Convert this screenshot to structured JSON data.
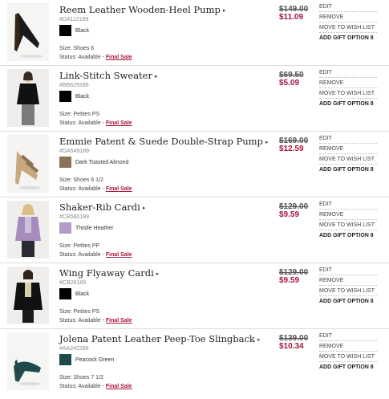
{
  "actions": {
    "edit": "EDIT",
    "remove": "REMOVE",
    "move": "MOVE TO WISH LIST",
    "gift": "ADD GIFT OPTION"
  },
  "status_prefix": "Status: Available -",
  "final_sale": "Final Sale",
  "items": [
    {
      "name": "Reem Leather Wooden-Heel Pump",
      "sku": "#DA112189",
      "color_name": "Black",
      "swatch": "#000000",
      "size": "Size: Shoes 6",
      "original_price": "$149.00",
      "sale_price": "$11.09",
      "gift_count": "8",
      "icon": "black-pump-shoe"
    },
    {
      "name": "Link-Stitch Sweater",
      "sku": "#BB629286",
      "color_name": "Black",
      "swatch": "#000000",
      "size": "Size: Petites PS",
      "original_price": "$69.50",
      "sale_price": "$5.09",
      "gift_count": "8",
      "icon": "model-black-sweater"
    },
    {
      "name": "Emmie Patent & Suede Double-Strap Pump",
      "sku": "#DA549189",
      "color_name": "Dark Toasted Almond",
      "swatch": "#8b7358",
      "size": "Size: Shoes 6 1/2",
      "original_price": "$169.00",
      "sale_price": "$12.59",
      "gift_count": "8",
      "icon": "almond-double-strap-pump"
    },
    {
      "name": "Shaker-Rib Cardi",
      "sku": "#CB580189",
      "color_name": "Thistle Heather",
      "swatch": "#b49ac6",
      "size": "Size: Petites PP",
      "original_price": "$129.00",
      "sale_price": "$9.59",
      "gift_count": "8",
      "icon": "model-thistle-cardigan"
    },
    {
      "name": "Wing Flyaway Cardi",
      "sku": "#CB26189",
      "color_name": "Black",
      "swatch": "#000000",
      "size": "Size: Petites PS",
      "original_price": "$129.00",
      "sale_price": "$9.59",
      "gift_count": "8",
      "icon": "model-black-flyaway-cardigan"
    },
    {
      "name": "Jolena Patent Leather Peep-Toe Slingback",
      "sku": "#AA242286",
      "color_name": "Peacock Green",
      "swatch": "#1f4a4c",
      "size": "Size: Shoes 7 1/2",
      "original_price": "$139.00",
      "sale_price": "$10.34",
      "gift_count": "8",
      "icon": "peacock-slingback-shoe"
    }
  ]
}
